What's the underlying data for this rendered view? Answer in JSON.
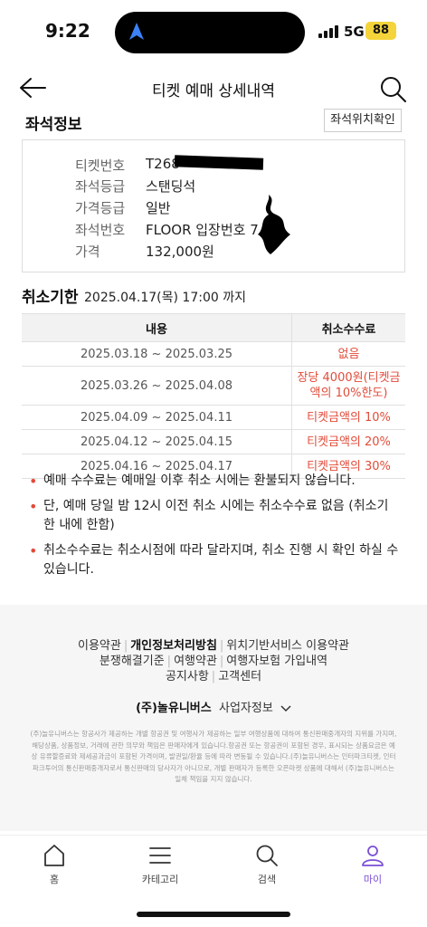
{
  "status_bar": {
    "time": "9:22",
    "network": "5G",
    "battery": "88"
  },
  "header": {
    "title": "티켓 예매 상세내역"
  },
  "seat_info": {
    "title": "좌석정보",
    "seat_map_button": "좌석위치확인",
    "rows": [
      {
        "label": "티켓번호",
        "value": "T268"
      },
      {
        "label": "좌석등급",
        "value": "스탠딩석"
      },
      {
        "label": "가격등급",
        "value": "일반"
      },
      {
        "label": "좌석번호",
        "value": "FLOOR 입장번호 7"
      },
      {
        "label": "가격",
        "value": "132,000원"
      }
    ]
  },
  "cancel": {
    "label": "취소기한",
    "deadline": "2025.04.17(목) 17:00 까지",
    "table": {
      "headers": [
        "내용",
        "취소수수료"
      ],
      "rows": [
        {
          "period": "2025.03.18 ~ 2025.03.25",
          "fee": "없음"
        },
        {
          "period": "2025.03.26 ~ 2025.04.08",
          "fee": "장당 4000원(티켓금액의 10%한도)"
        },
        {
          "period": "2025.04.09 ~ 2025.04.11",
          "fee": "티켓금액의 10%"
        },
        {
          "period": "2025.04.12 ~ 2025.04.15",
          "fee": "티켓금액의 20%"
        },
        {
          "period": "2025.04.16 ~ 2025.04.17",
          "fee": "티켓금액의 30%"
        }
      ]
    }
  },
  "notes": [
    "예매 수수료는 예매일 이후 취소 시에는 환불되지 않습니다.",
    "단, 예매 당일 밤 12시 이전 취소 시에는 취소수수료 없음 (취소기한 내에 한함)",
    "취소수수료는 취소시점에 따라 달라지며, 취소 진행 시 확인 하실 수 있습니다."
  ],
  "footer": {
    "links": {
      "terms": "이용약관",
      "privacy": "개인정보처리방침",
      "location": "위치기반서비스 이용약관",
      "dispute": "분쟁해결기준",
      "travel_terms": "여행약관",
      "travel_insurance": "여행자보험 가입내역",
      "notice": "공지사항",
      "support": "고객센터"
    },
    "company": "(주)놀유니버스",
    "company_info": "사업자정보",
    "legal": "(주)놀유니버스는 항공사가 제공하는 개별 항공권 및 여행사가 제공하는 일부 여행상품에 대하여 통신판매중개자의 지위를 가지며, 해당상품, 상품정보, 거래에 관한 의무와 책임은 판매자에게 있습니다.항공권 또는 항공권이 포함된 경우, 표시되는 상품요금은 예상 유류할증료와 제세공과금이 포함된 가격이며, 발권일/환율 등에 따라 변동될 수 있습니다.(주)놀유니버스는 인터파크티켓, 인터파크투어의 통신판매중개자로서 통신판매의 당사자가 아니므로, 개별 판매자가 등록한 오픈마켓 상품에 대해서 (주)놀유니버스는 일체 책임을 지지 않습니다."
  },
  "tabbar": {
    "items": [
      "홈",
      "카테고리",
      "검색",
      "마이"
    ],
    "active": "마이"
  },
  "colors": {
    "accent": "#7a4fd6",
    "fee_red": "#e24c3a",
    "battery": "#f4d43a"
  }
}
